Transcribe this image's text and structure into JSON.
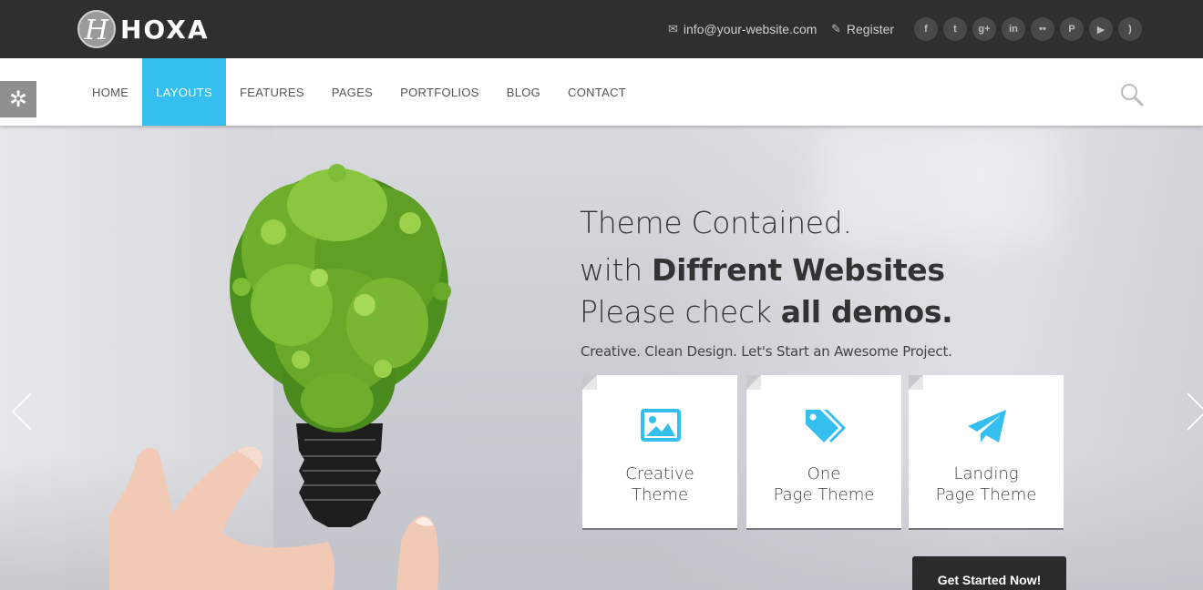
{
  "brand": {
    "logo_letter": "H",
    "name": "HOXA"
  },
  "topbar": {
    "email": "info@your-website.com",
    "register": "Register",
    "socials": [
      {
        "name": "facebook-icon",
        "glyph": "f"
      },
      {
        "name": "twitter-icon",
        "glyph": "t"
      },
      {
        "name": "google-plus-icon",
        "glyph": "g+"
      },
      {
        "name": "linkedin-icon",
        "glyph": "in"
      },
      {
        "name": "flickr-icon",
        "glyph": "••"
      },
      {
        "name": "pinterest-icon",
        "glyph": "P"
      },
      {
        "name": "youtube-icon",
        "glyph": "▶"
      },
      {
        "name": "rss-icon",
        "glyph": ")"
      }
    ]
  },
  "nav": {
    "items": [
      "HOME",
      "LAYOUTS",
      "FEATURES",
      "PAGES",
      "PORTFOLIOS",
      "BLOG",
      "CONTACT"
    ],
    "active_index": 1
  },
  "hero": {
    "line1": "Theme Contained.",
    "line2_prefix": "with ",
    "line2_bold": "Diffrent Websites",
    "line3_prefix": "Please check ",
    "line3_bold": "all demos.",
    "subline": "Creative. Clean Design. Let's Start an Awesome Project.",
    "cards": [
      {
        "line1": "Creative",
        "line2": "Theme",
        "icon": "image-icon"
      },
      {
        "line1": "One",
        "line2": "Page Theme",
        "icon": "tags-icon"
      },
      {
        "line1": "Landing",
        "line2": "Page Theme",
        "icon": "paper-plane-icon"
      }
    ],
    "cta": "Get Started Now!"
  },
  "colors": {
    "accent": "#35bff0",
    "topbar": "#2f2f2f",
    "cta": "#2b2b2b"
  }
}
